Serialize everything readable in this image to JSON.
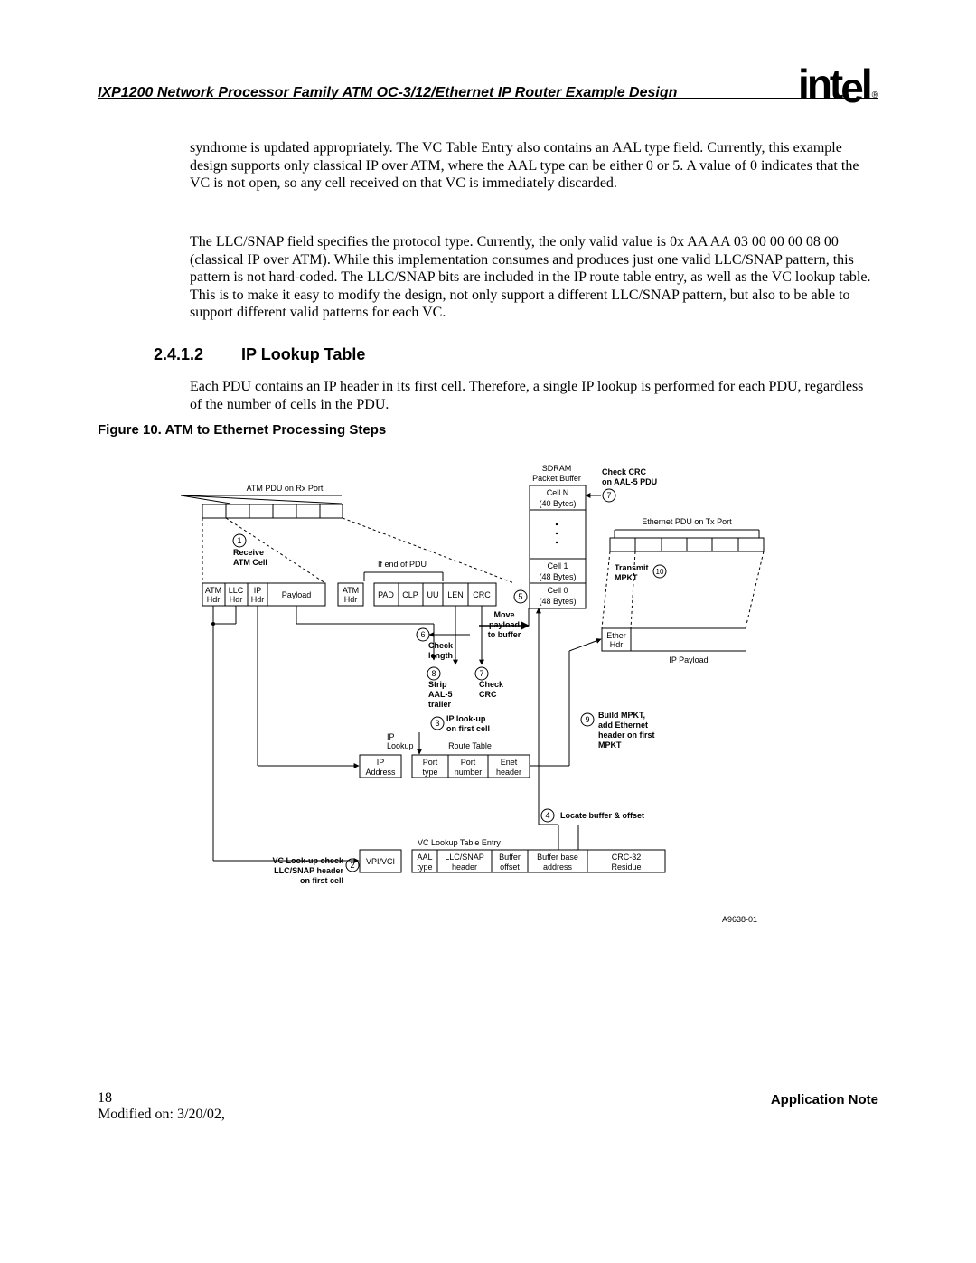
{
  "header": {
    "title": "IXP1200 Network Processor Family ATM OC-3/12/Ethernet IP Router Example Design",
    "logo": "intel",
    "reg": "®"
  },
  "paragraphs": {
    "p1": "syndrome is updated appropriately. The VC Table Entry also contains an AAL type field. Currently, this example design supports only classical IP over ATM, where the AAL type can be either 0 or 5. A value of 0 indicates that the VC is not open, so any cell received on that VC is immediately discarded.",
    "p2": "The LLC/SNAP field specifies the protocol type. Currently, the only valid value is 0x AA AA 03 00 00 00 08 00 (classical IP over ATM). While this implementation consumes and produces just one valid LLC/SNAP pattern, this pattern is not hard-coded. The LLC/SNAP bits are included in the IP route table entry, as well as the VC lookup table. This is to make it easy to modify the design, not only support a different LLC/SNAP pattern, but also to be able to support different valid patterns for each VC.",
    "p3": "Each PDU contains an IP header in its first cell. Therefore, a single IP lookup is performed for each PDU, regardless of the number of cells in the PDU."
  },
  "section": {
    "number": "2.4.1.2",
    "title": "IP Lookup Table"
  },
  "figure": {
    "caption": "Figure 10. ATM to Ethernet Processing Steps",
    "ref": "A9638-01",
    "labels": {
      "sdram": "SDRAM",
      "packet_buffer": "Packet Buffer",
      "atm_pdu": "ATM PDU on Rx Port",
      "check_crc_aal5_1": "Check CRC",
      "check_crc_aal5_2": "on AAL-5 PDU",
      "celln": "Cell N",
      "celln_size": "(40 Bytes)",
      "eth_pdu": "Ethernet PDU on Tx Port",
      "cell1": "Cell 1",
      "cell1_size": "(48 Bytes)",
      "cell0": "Cell 0",
      "cell0_size": "(48 Bytes)",
      "receive1": "Receive",
      "receive2": "ATM Cell",
      "if_end": "If end of PDU",
      "transmit1": "Transmit",
      "transmit2": "MPKT",
      "atm_hdr1": "ATM",
      "atm_hdr2": "Hdr",
      "llc_hdr1": "LLC",
      "llc_hdr2": "Hdr",
      "ip_hdr1": "IP",
      "ip_hdr2": "Hdr",
      "payload": "Payload",
      "pad": "PAD",
      "clp": "CLP",
      "uu": "UU",
      "len": "LEN",
      "crc": "CRC",
      "move1": "Move",
      "move2": "payload",
      "move3": "to buffer",
      "ether1": "Ether",
      "ether2": "Hdr",
      "ip_payload": "IP Payload",
      "check_len1": "Check",
      "check_len2": "length",
      "strip1": "Strip",
      "strip2": "AAL-5",
      "strip3": "trailer",
      "check_crc1": "Check",
      "check_crc2": "CRC",
      "ip_lookup1": "IP look-up",
      "ip_lookup2": "on first cell",
      "ip_lookup_lbl1": "IP",
      "ip_lookup_lbl2": "Lookup",
      "route_table": "Route Table",
      "ip_addr1": "IP",
      "ip_addr2": "Address",
      "port_type1": "Port",
      "port_type2": "type",
      "port_num1": "Port",
      "port_num2": "number",
      "enet_hdr1": "Enet",
      "enet_hdr2": "header",
      "build1": "Build MPKT,",
      "build2": "add Ethernet",
      "build3": "header on first",
      "build4": "MPKT",
      "locate": "Locate buffer & offset",
      "vc_entry": "VC Lookup Table Entry",
      "vpi_vci": "VPI/VCI",
      "aal1": "AAL",
      "aal2": "type",
      "llcsnap1": "LLC/SNAP",
      "llcsnap2": "header",
      "buf_off1": "Buffer",
      "buf_off2": "offset",
      "buf_base1": "Buffer base",
      "buf_base2": "address",
      "crc32_1": "CRC-32",
      "crc32_2": "Residue",
      "vc_chk1": "VC Look-up check",
      "vc_chk2": "LLC/SNAP header",
      "vc_chk3": "on first cell"
    },
    "steps": {
      "s1": "1",
      "s2": "2",
      "s3": "3",
      "s4": "4",
      "s5": "5",
      "s6": "6",
      "s7": "7",
      "s7b": "7",
      "s8": "8",
      "s9": "9",
      "s10": "10"
    }
  },
  "footer": {
    "page": "18",
    "modified": "Modified on: 3/20/02,",
    "note": "Application Note"
  }
}
